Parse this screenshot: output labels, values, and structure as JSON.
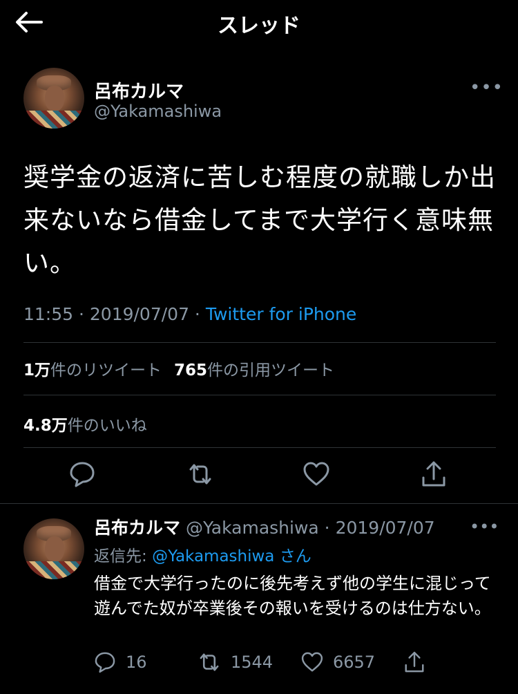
{
  "header": {
    "title": "スレッド"
  },
  "tweet": {
    "author_name": "呂布カルマ",
    "author_handle": "@Yakamashiwa",
    "more": "•••",
    "text": "奨学金の返済に苦しむ程度の就職しか出来ないなら借金してまで大学行く意味無い。",
    "time": "11:55",
    "date_sep": " · ",
    "date": "2019/07/07",
    "source_sep": " · ",
    "source": "Twitter for iPhone",
    "retweets_num": "1万",
    "retweets_label": "件のリツイート",
    "quotes_num": "765",
    "quotes_label": "件の引用ツイート",
    "likes_num": "4.8万",
    "likes_label": "件のいいね"
  },
  "reply": {
    "author_name": "呂布カルマ",
    "author_handle": "@Yakamashiwa",
    "date": "2019/07/07",
    "date_sep": " · ",
    "more": "•••",
    "reply_prefix": "返信先: ",
    "reply_to": "@Yakamashiwa",
    "reply_suffix": " さん",
    "text": "借金で大学行ったのに後先考えず他の学生に混じって遊んでた奴が卒業後その報いを受けるのは仕方ない。",
    "reply_count": "16",
    "retweet_count": "1544",
    "like_count": "6657"
  },
  "icons": {
    "back": "back-arrow-icon",
    "reply": "reply-bubble-icon",
    "retweet": "retweet-icon",
    "like": "heart-icon",
    "share": "share-icon"
  },
  "colors": {
    "background": "#000000",
    "text": "#ffffff",
    "secondary": "#8b98a5",
    "link": "#1d9bf0",
    "divider": "#2f3336"
  }
}
